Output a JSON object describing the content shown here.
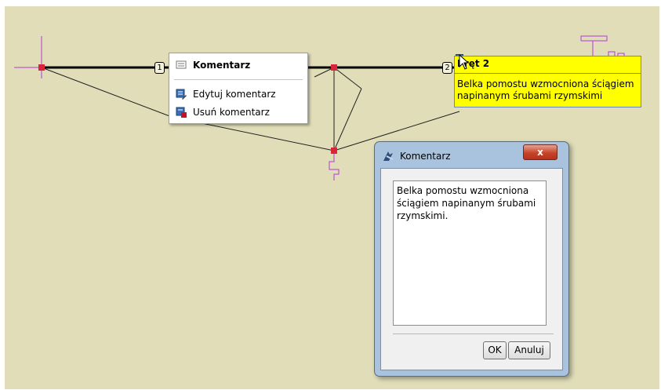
{
  "bars": [
    {
      "label": "1"
    },
    {
      "label": "2"
    }
  ],
  "context_menu": {
    "header": "Komentarz",
    "items": [
      {
        "label": "Edytuj komentarz",
        "icon": "edit-comment-icon"
      },
      {
        "label": "Usuń komentarz",
        "icon": "delete-comment-icon"
      }
    ]
  },
  "tooltip": {
    "title": "Pręt 2",
    "body": "Belka pomostu wzmocniona ściągiem napinanym śrubami rzymskimi"
  },
  "dialog": {
    "title": "Komentarz",
    "close_label": "x",
    "text": "Belka pomostu wzmocniona ściągiem napinanym śrubami rzymskimi.",
    "ok_label": "OK",
    "cancel_label": "Anuluj"
  },
  "colors": {
    "canvas_bg": "#e0ddb8",
    "node": "#d9253a",
    "support": "#b43cd9",
    "tooltip_bg": "#ffff00"
  }
}
